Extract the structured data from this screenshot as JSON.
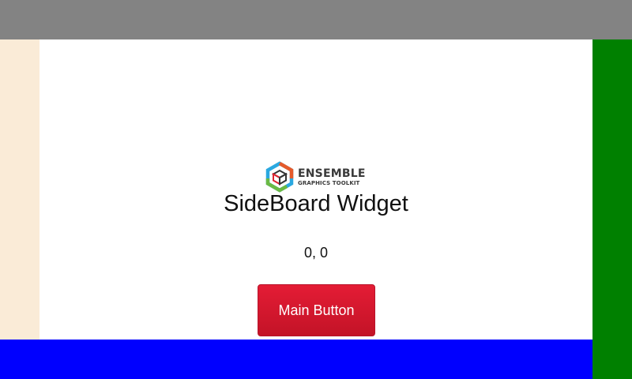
{
  "panels": {
    "top_color": "#838383",
    "left_color": "#faebd7",
    "right_color": "#008000",
    "bottom_color": "#0000ff"
  },
  "logo": {
    "icon": "ensemble-cube-icon",
    "word": "ENSEMBLE",
    "subtitle": "GRAPHICS TOOLKIT",
    "text_color": "#3a3a3a"
  },
  "widget": {
    "title": "SideBoard Widget",
    "coordinates": "0, 0",
    "main_button_label": "Main Button",
    "button_color_top": "#e41c35",
    "button_color_bottom": "#c31327"
  }
}
